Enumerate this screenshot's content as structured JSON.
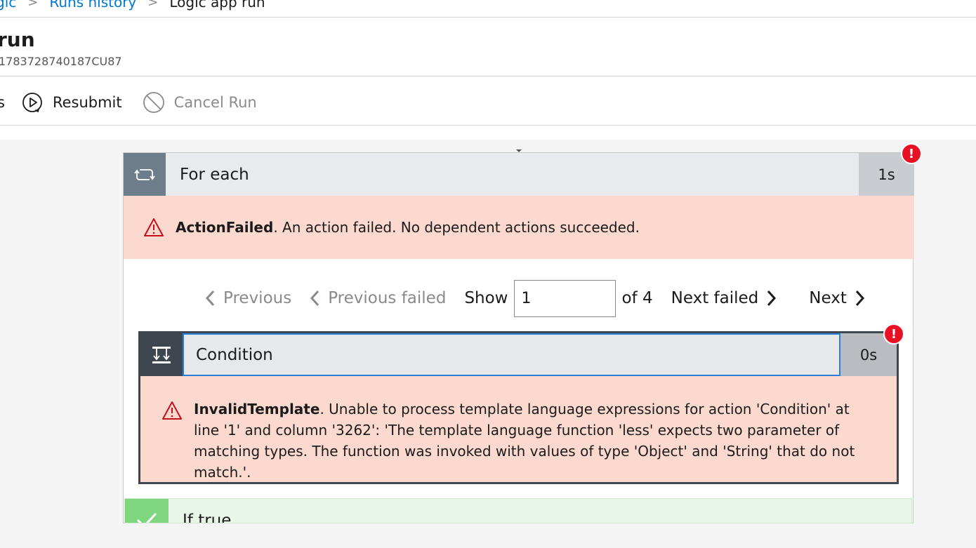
{
  "breadcrumb": {
    "item1": "gic",
    "item2": "Runs history",
    "current": "Logic app run",
    "separator": ">"
  },
  "page": {
    "title": "run",
    "run_id": "1783728740187CU87"
  },
  "toolbar": {
    "partial_label": "s",
    "resubmit_label": "Resubmit",
    "cancel_label": "Cancel Run",
    "icons": {
      "resubmit": "play-circle-icon",
      "cancel": "cancel-circle-icon"
    }
  },
  "foreach": {
    "title": "For each",
    "duration": "1s",
    "error_code": "ActionFailed",
    "error_message": ". An action failed. No dependent actions succeeded.",
    "badge": "!"
  },
  "pager": {
    "previous_label": "Previous",
    "previous_failed_label": "Previous failed",
    "show_label": "Show",
    "current_value": "1",
    "of_label": "of 4",
    "next_failed_label": "Next failed",
    "next_label": "Next"
  },
  "condition": {
    "title": "Condition",
    "duration": "0s",
    "error_code": "InvalidTemplate",
    "error_message": ". Unable to process template language expressions for action 'Condition' at line '1' and column '3262': 'The template language function 'less' expects two parameter of matching types. The function was invoked with values of type 'Object' and 'String' that do not match.'.",
    "badge": "!"
  },
  "if_true": {
    "title": "If true"
  },
  "colors": {
    "link": "#0078d4",
    "error_bg": "#fbd9ce",
    "error_red": "#e81123",
    "success_green": "#7ed67e"
  }
}
